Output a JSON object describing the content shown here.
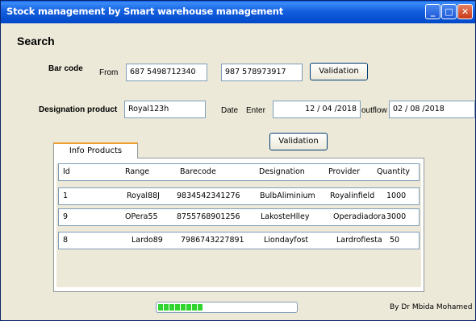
{
  "window": {
    "title": "Stock management by Smart warehouse management",
    "minimize_icon": "minimize-icon",
    "maximize_icon": "maximize-icon",
    "close_icon": "close-icon"
  },
  "search": {
    "heading": "Search",
    "barcode": {
      "label": "Bar code",
      "from_label": "From",
      "from_value": "687 5498712340",
      "to_value": "987 578973917",
      "validate_label": "Validation"
    },
    "designation": {
      "label": "Designation product",
      "value": "Royal123h",
      "date_label": "Date",
      "enter_label": "Enter",
      "enter_date": "12 /  04   /2018",
      "outflow_label": "outflow",
      "outflow_date": "02 /  08  /2018"
    },
    "validate_label": "Validation"
  },
  "info_products": {
    "tab_label": "Info Products",
    "columns": [
      "Id",
      "Range",
      "Barecode",
      "Designation",
      "Provider",
      "Quantity"
    ],
    "rows": [
      [
        "1",
        "Royal88J",
        "9834542341276",
        "BulbAliminium",
        "Royalinfield",
        "1000"
      ],
      [
        "9",
        "OPera55",
        "8755768901256",
        "LakosteHlley",
        "Operadiadora",
        "3000"
      ],
      [
        "8",
        "Lardo89",
        "7986743227891",
        "Liondayfost",
        "Lardrofiesta",
        "50"
      ]
    ]
  },
  "progress": {
    "value": 0.33,
    "segments_filled": 8
  },
  "credit": "By Dr Mbida Mohamed",
  "colors": {
    "titlebar": "#0a5ae8",
    "window_bg": "#ece9d8",
    "progress": "#2fd42f",
    "tab_accent": "#f0a030"
  }
}
